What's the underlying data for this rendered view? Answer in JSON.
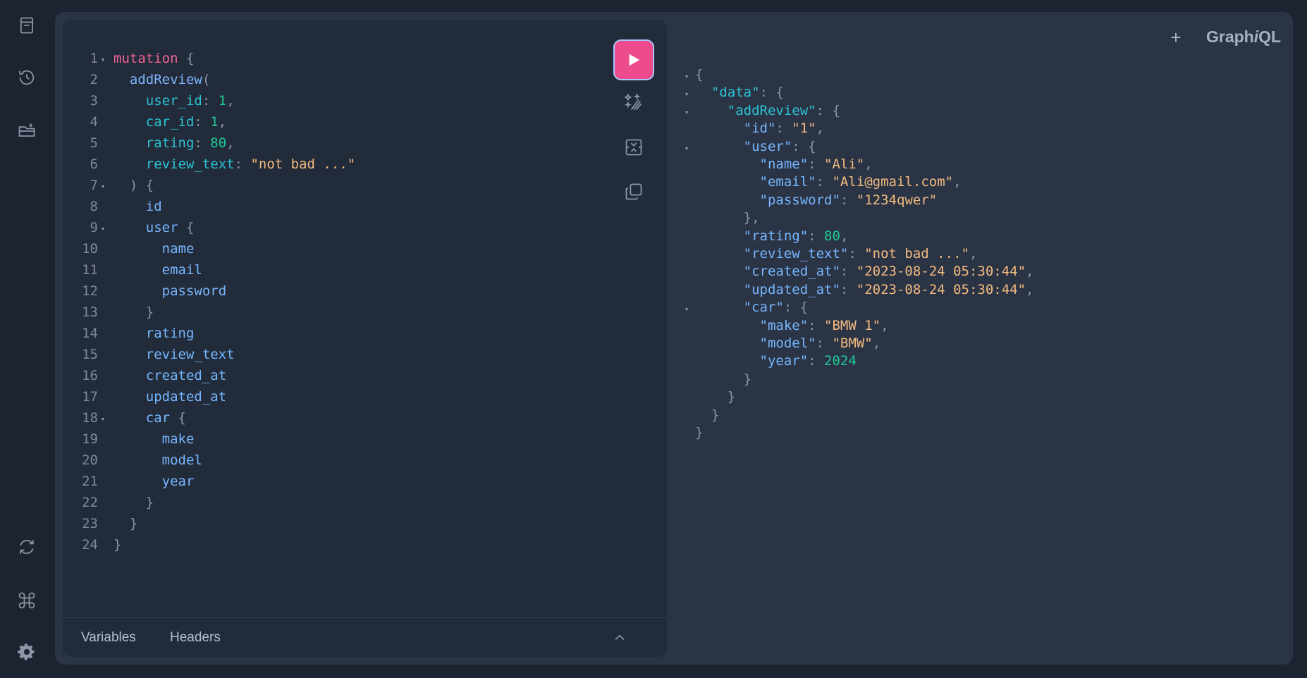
{
  "app": {
    "name": "GraphiQL",
    "name_prefix": "Graph",
    "name_italic": "i",
    "name_suffix": "QL"
  },
  "sidebar": {
    "top_items": [
      {
        "name": "docs-icon",
        "label": "Documentation Explorer"
      },
      {
        "name": "history-icon",
        "label": "History"
      },
      {
        "name": "folder-plus-icon",
        "label": "Collections"
      }
    ],
    "bottom_items": [
      {
        "name": "refresh-icon",
        "label": "Re-fetch schema"
      },
      {
        "name": "command-icon",
        "label": "Keyboard shortcuts"
      },
      {
        "name": "settings-icon",
        "label": "Settings"
      }
    ]
  },
  "toolbar": {
    "run_label": "Execute query",
    "prettify_label": "Prettify query",
    "merge_label": "Merge fragments",
    "copy_label": "Copy query",
    "add_tab_label": "+"
  },
  "editor": {
    "lines": [
      {
        "n": "1",
        "fold": true,
        "tokens": [
          {
            "t": "mutation",
            "c": "kw"
          },
          {
            "t": " {",
            "c": "pun"
          }
        ]
      },
      {
        "n": "2",
        "fold": false,
        "tokens": [
          {
            "t": "  addReview",
            "c": "fn"
          },
          {
            "t": "(",
            "c": "pun"
          }
        ]
      },
      {
        "n": "3",
        "fold": false,
        "tokens": [
          {
            "t": "    user_id",
            "c": "arg"
          },
          {
            "t": ": ",
            "c": "pun"
          },
          {
            "t": "1",
            "c": "num"
          },
          {
            "t": ",",
            "c": "pun"
          }
        ]
      },
      {
        "n": "4",
        "fold": false,
        "tokens": [
          {
            "t": "    car_id",
            "c": "arg"
          },
          {
            "t": ": ",
            "c": "pun"
          },
          {
            "t": "1",
            "c": "num"
          },
          {
            "t": ",",
            "c": "pun"
          }
        ]
      },
      {
        "n": "5",
        "fold": false,
        "tokens": [
          {
            "t": "    rating",
            "c": "arg"
          },
          {
            "t": ": ",
            "c": "pun"
          },
          {
            "t": "80",
            "c": "num"
          },
          {
            "t": ",",
            "c": "pun"
          }
        ]
      },
      {
        "n": "6",
        "fold": false,
        "tokens": [
          {
            "t": "    review_text",
            "c": "arg"
          },
          {
            "t": ": ",
            "c": "pun"
          },
          {
            "t": "\"not bad ...\"",
            "c": "str"
          }
        ]
      },
      {
        "n": "7",
        "fold": true,
        "tokens": [
          {
            "t": "  ) {",
            "c": "pun"
          }
        ]
      },
      {
        "n": "8",
        "fold": false,
        "tokens": [
          {
            "t": "    id",
            "c": "fld"
          }
        ]
      },
      {
        "n": "9",
        "fold": true,
        "tokens": [
          {
            "t": "    user",
            "c": "fld"
          },
          {
            "t": " {",
            "c": "pun"
          }
        ]
      },
      {
        "n": "10",
        "fold": false,
        "tokens": [
          {
            "t": "      name",
            "c": "fld"
          }
        ]
      },
      {
        "n": "11",
        "fold": false,
        "tokens": [
          {
            "t": "      email",
            "c": "fld"
          }
        ]
      },
      {
        "n": "12",
        "fold": false,
        "tokens": [
          {
            "t": "      password",
            "c": "fld"
          }
        ]
      },
      {
        "n": "13",
        "fold": false,
        "tokens": [
          {
            "t": "    }",
            "c": "pun"
          }
        ]
      },
      {
        "n": "14",
        "fold": false,
        "tokens": [
          {
            "t": "    rating",
            "c": "fld"
          }
        ]
      },
      {
        "n": "15",
        "fold": false,
        "tokens": [
          {
            "t": "    review_text",
            "c": "fld"
          }
        ]
      },
      {
        "n": "16",
        "fold": false,
        "tokens": [
          {
            "t": "    created_at",
            "c": "fld"
          }
        ]
      },
      {
        "n": "17",
        "fold": false,
        "tokens": [
          {
            "t": "    updated_at",
            "c": "fld"
          }
        ]
      },
      {
        "n": "18",
        "fold": true,
        "tokens": [
          {
            "t": "    car",
            "c": "fld"
          },
          {
            "t": " {",
            "c": "pun"
          }
        ]
      },
      {
        "n": "19",
        "fold": false,
        "tokens": [
          {
            "t": "      make",
            "c": "fld"
          }
        ]
      },
      {
        "n": "20",
        "fold": false,
        "tokens": [
          {
            "t": "      model",
            "c": "fld"
          }
        ]
      },
      {
        "n": "21",
        "fold": false,
        "tokens": [
          {
            "t": "      year",
            "c": "fld"
          }
        ]
      },
      {
        "n": "22",
        "fold": false,
        "tokens": [
          {
            "t": "    }",
            "c": "pun"
          }
        ]
      },
      {
        "n": "23",
        "fold": false,
        "tokens": [
          {
            "t": "  }",
            "c": "pun"
          }
        ]
      },
      {
        "n": "24",
        "fold": false,
        "tokens": [
          {
            "t": "}",
            "c": "pun"
          }
        ]
      }
    ]
  },
  "bottom_tabs": {
    "variables": "Variables",
    "headers": "Headers"
  },
  "result": {
    "lines": [
      {
        "fold": true,
        "tokens": [
          {
            "t": "{",
            "c": "pun"
          }
        ]
      },
      {
        "fold": true,
        "tokens": [
          {
            "t": "  \"data\"",
            "c": "arg"
          },
          {
            "t": ": {",
            "c": "pun"
          }
        ]
      },
      {
        "fold": true,
        "tokens": [
          {
            "t": "    \"addReview\"",
            "c": "arg"
          },
          {
            "t": ": {",
            "c": "pun"
          }
        ]
      },
      {
        "fold": false,
        "tokens": [
          {
            "t": "      \"id\"",
            "c": "key"
          },
          {
            "t": ": ",
            "c": "pun"
          },
          {
            "t": "\"1\"",
            "c": "str"
          },
          {
            "t": ",",
            "c": "pun"
          }
        ]
      },
      {
        "fold": true,
        "tokens": [
          {
            "t": "      \"user\"",
            "c": "key"
          },
          {
            "t": ": {",
            "c": "pun"
          }
        ]
      },
      {
        "fold": false,
        "tokens": [
          {
            "t": "        \"name\"",
            "c": "key"
          },
          {
            "t": ": ",
            "c": "pun"
          },
          {
            "t": "\"Ali\"",
            "c": "str"
          },
          {
            "t": ",",
            "c": "pun"
          }
        ]
      },
      {
        "fold": false,
        "tokens": [
          {
            "t": "        \"email\"",
            "c": "key"
          },
          {
            "t": ": ",
            "c": "pun"
          },
          {
            "t": "\"Ali@gmail.com\"",
            "c": "str"
          },
          {
            "t": ",",
            "c": "pun"
          }
        ]
      },
      {
        "fold": false,
        "tokens": [
          {
            "t": "        \"password\"",
            "c": "key"
          },
          {
            "t": ": ",
            "c": "pun"
          },
          {
            "t": "\"1234qwer\"",
            "c": "str"
          }
        ]
      },
      {
        "fold": false,
        "tokens": [
          {
            "t": "      },",
            "c": "pun"
          }
        ]
      },
      {
        "fold": false,
        "tokens": [
          {
            "t": "      \"rating\"",
            "c": "key"
          },
          {
            "t": ": ",
            "c": "pun"
          },
          {
            "t": "80",
            "c": "num"
          },
          {
            "t": ",",
            "c": "pun"
          }
        ]
      },
      {
        "fold": false,
        "tokens": [
          {
            "t": "      \"review_text\"",
            "c": "key"
          },
          {
            "t": ": ",
            "c": "pun"
          },
          {
            "t": "\"not bad ...\"",
            "c": "str"
          },
          {
            "t": ",",
            "c": "pun"
          }
        ]
      },
      {
        "fold": false,
        "tokens": [
          {
            "t": "      \"created_at\"",
            "c": "key"
          },
          {
            "t": ": ",
            "c": "pun"
          },
          {
            "t": "\"2023-08-24 05:30:44\"",
            "c": "str"
          },
          {
            "t": ",",
            "c": "pun"
          }
        ]
      },
      {
        "fold": false,
        "tokens": [
          {
            "t": "      \"updated_at\"",
            "c": "key"
          },
          {
            "t": ": ",
            "c": "pun"
          },
          {
            "t": "\"2023-08-24 05:30:44\"",
            "c": "str"
          },
          {
            "t": ",",
            "c": "pun"
          }
        ]
      },
      {
        "fold": true,
        "tokens": [
          {
            "t": "      \"car\"",
            "c": "key"
          },
          {
            "t": ": {",
            "c": "pun"
          }
        ]
      },
      {
        "fold": false,
        "tokens": [
          {
            "t": "        \"make\"",
            "c": "key"
          },
          {
            "t": ": ",
            "c": "pun"
          },
          {
            "t": "\"BMW 1\"",
            "c": "str"
          },
          {
            "t": ",",
            "c": "pun"
          }
        ]
      },
      {
        "fold": false,
        "tokens": [
          {
            "t": "        \"model\"",
            "c": "key"
          },
          {
            "t": ": ",
            "c": "pun"
          },
          {
            "t": "\"BMW\"",
            "c": "str"
          },
          {
            "t": ",",
            "c": "pun"
          }
        ]
      },
      {
        "fold": false,
        "tokens": [
          {
            "t": "        \"year\"",
            "c": "key"
          },
          {
            "t": ": ",
            "c": "pun"
          },
          {
            "t": "2024",
            "c": "num"
          }
        ]
      },
      {
        "fold": false,
        "tokens": [
          {
            "t": "      }",
            "c": "pun"
          }
        ]
      },
      {
        "fold": false,
        "tokens": [
          {
            "t": "    }",
            "c": "pun"
          }
        ]
      },
      {
        "fold": false,
        "tokens": [
          {
            "t": "  }",
            "c": "pun"
          }
        ]
      },
      {
        "fold": false,
        "tokens": [
          {
            "t": "}",
            "c": "pun"
          }
        ]
      }
    ]
  },
  "colors": {
    "background": "#1c2431",
    "panel": "#2b3445",
    "editor": "#222b3a",
    "run_button": "#ec4c8b"
  }
}
